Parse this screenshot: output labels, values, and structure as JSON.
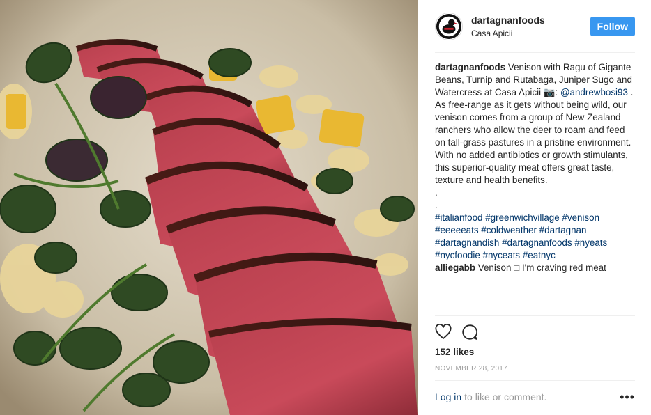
{
  "post": {
    "username": "dartagnanfoods",
    "location": "Casa Apicii",
    "follow_label": "Follow",
    "caption_title": "Venison with Ragu of Gigante Beans, Turnip and Rutabaga, Juniper Sugo and Watercress at Casa Apicii",
    "camera_glyph": "📷:",
    "photo_credit": "@andrewbosi93",
    "credit_end": " .",
    "caption_body": "As free-range as it gets without being wild, our venison comes from a group of New Zealand ranchers who allow the deer to roam and feed on tall-grass pastures in a pristine environment. With no added antibiotics or growth stimulants, this superior-quality meat offers great taste, texture and health benefits.",
    "dot1": ".",
    "dot2": ".",
    "hashtags": [
      "#italianfood",
      "#greenwichvillage",
      "#venison",
      "#eeeeeats",
      "#coldweather",
      "#dartagnan",
      "#dartagnandish",
      "#dartagnanfoods",
      "#nyeats",
      "#nycfoodie",
      "#nyceats",
      "#eatnyc"
    ],
    "comment": {
      "username": "alliegabb",
      "text": "Venison □ I'm craving red meat"
    },
    "likes": "152 likes",
    "date": "NOVEMBER 28, 2017",
    "login_link": "Log in",
    "login_rest": "to like or comment.",
    "more_label": "•••"
  },
  "icons": {
    "like": "heart-icon",
    "comment": "comment-icon",
    "more": "more-options-icon",
    "avatar": "duck-logo"
  },
  "colors": {
    "follow_button": "#3897f0",
    "link": "#003569",
    "muted": "#999999"
  }
}
